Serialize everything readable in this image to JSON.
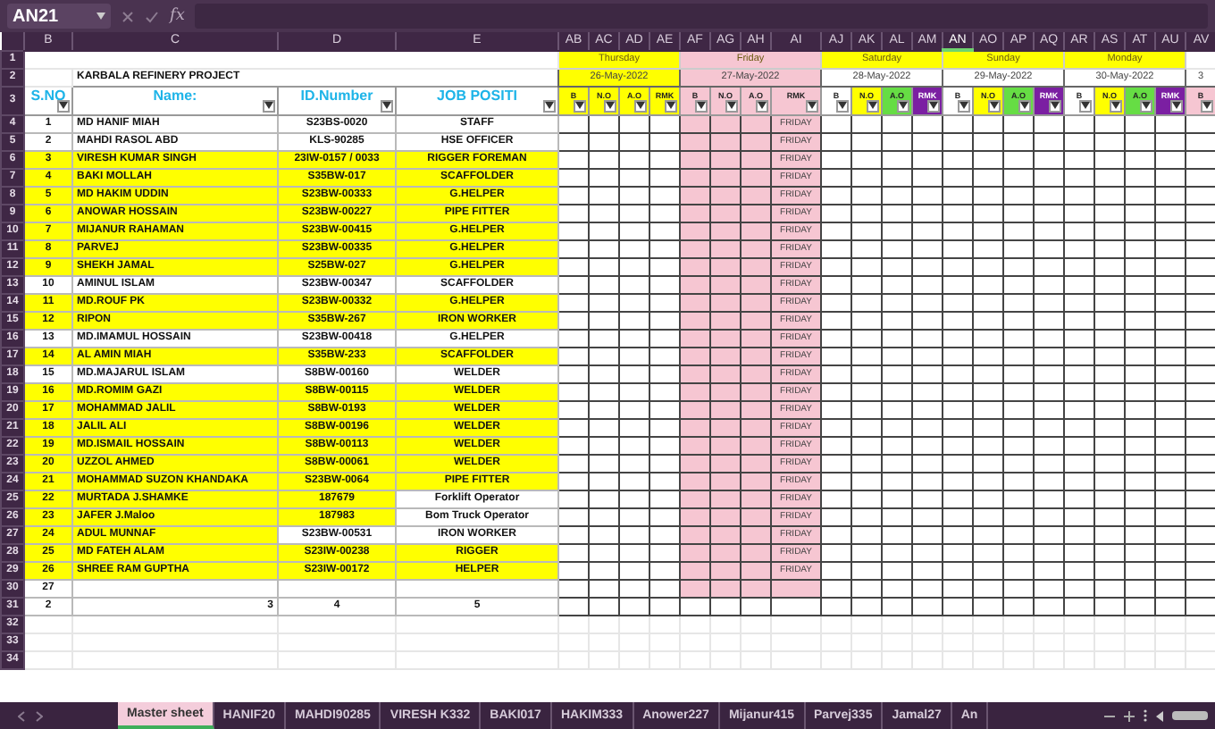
{
  "name_box": "AN21",
  "formula_label": "fx",
  "columns": [
    {
      "letter": "B",
      "selected": false
    },
    {
      "letter": "C",
      "selected": false
    },
    {
      "letter": "D",
      "selected": false
    },
    {
      "letter": "E",
      "selected": false
    },
    {
      "letter": "AB",
      "selected": false
    },
    {
      "letter": "AC",
      "selected": false
    },
    {
      "letter": "AD",
      "selected": false
    },
    {
      "letter": "AE",
      "selected": false
    },
    {
      "letter": "AF",
      "selected": false
    },
    {
      "letter": "AG",
      "selected": false
    },
    {
      "letter": "AH",
      "selected": false
    },
    {
      "letter": "AI",
      "selected": false
    },
    {
      "letter": "AJ",
      "selected": false
    },
    {
      "letter": "AK",
      "selected": false
    },
    {
      "letter": "AL",
      "selected": false
    },
    {
      "letter": "AM",
      "selected": false
    },
    {
      "letter": "AN",
      "selected": true
    },
    {
      "letter": "AO",
      "selected": false
    },
    {
      "letter": "AP",
      "selected": false
    },
    {
      "letter": "AQ",
      "selected": false
    },
    {
      "letter": "AR",
      "selected": false
    },
    {
      "letter": "AS",
      "selected": false
    },
    {
      "letter": "AT",
      "selected": false
    },
    {
      "letter": "AU",
      "selected": false
    },
    {
      "letter": "AV",
      "selected": false
    }
  ],
  "row_numbers": [
    "1",
    "2",
    "3",
    "4",
    "5",
    "6",
    "7",
    "8",
    "9",
    "10",
    "11",
    "12",
    "13",
    "14",
    "15",
    "16",
    "17",
    "18",
    "19",
    "20",
    "21",
    "22",
    "23",
    "24",
    "25",
    "26",
    "27",
    "28",
    "29",
    "30",
    "31",
    "32",
    "33",
    "34"
  ],
  "title": "KARBALA REFINERY PROJECT",
  "headers": [
    "S.NO",
    "Name:",
    "ID.Number",
    "JOB POSITI"
  ],
  "days": [
    {
      "day": "Thursday",
      "kind": "workday",
      "color": "#ffff00",
      "date": {
        "text": "26-May-2022",
        "color": "#ffff00"
      },
      "sub": [
        {
          "label": "B",
          "color": "#ffff00"
        },
        {
          "label": "N.O",
          "color": "#ffff00"
        },
        {
          "label": "A.O",
          "color": "#ffff00"
        },
        {
          "label": "RMK",
          "color": "#ffff00"
        }
      ]
    },
    {
      "day": "Friday",
      "kind": "holiday",
      "color": "#f6c6d2",
      "body": {
        "color": "#f6c6d2"
      },
      "date": {
        "text": "27-May-2022",
        "color": "#f6c6d2"
      },
      "sub": [
        {
          "label": "B",
          "color": "#f6c6d2"
        },
        {
          "label": "N.O",
          "color": "#f6c6d2"
        },
        {
          "label": "A.O",
          "color": "#f6c6d2"
        },
        {
          "label": "RMK",
          "color": "#f6c6d2"
        }
      ]
    },
    {
      "day": "Saturday",
      "kind": "workday",
      "color": "#ffff00",
      "date": {
        "text": "28-May-2022",
        "color": "#ffffff"
      },
      "sub": [
        {
          "label": "B",
          "color": "#ffffff"
        },
        {
          "label": "N.O",
          "color": "#ffff00"
        },
        {
          "label": "A.O",
          "color": "#66dd44"
        },
        {
          "label": "RMK",
          "color": "#7b1fa2"
        }
      ]
    },
    {
      "day": "Sunday",
      "kind": "workday",
      "color": "#ffff00",
      "date": {
        "text": "29-May-2022",
        "color": "#ffffff"
      },
      "sub": [
        {
          "label": "B",
          "color": "#ffffff"
        },
        {
          "label": "N.O",
          "color": "#ffff00"
        },
        {
          "label": "A.O",
          "color": "#66dd44"
        },
        {
          "label": "RMK",
          "color": "#7b1fa2"
        }
      ]
    },
    {
      "day": "Monday",
      "kind": "workday",
      "color": "#ffff00",
      "date": {
        "text": "30-May-2022",
        "color": "#ffffff"
      },
      "sub": [
        {
          "label": "B",
          "color": "#ffffff"
        },
        {
          "label": "N.O",
          "color": "#ffff00"
        },
        {
          "label": "A.O",
          "color": "#66dd44"
        },
        {
          "label": "RMK",
          "color": "#7b1fa2"
        }
      ]
    },
    {
      "kind": "workday",
      "color": "#ffffff",
      "date": {
        "text": "3",
        "color": "#ffffff"
      },
      "sub": [
        {
          "label": "B",
          "color": "#f6c6d2"
        }
      ]
    }
  ],
  "employees": [
    {
      "kind": "employee",
      "cells": [
        "1",
        "MD HANIF MIAH",
        "S23BS-0020",
        "STAFF"
      ],
      "highlighted": [
        false,
        false,
        false,
        false
      ],
      "friday_remark": "FRIDAY"
    },
    {
      "kind": "employee",
      "cells": [
        "2",
        "MAHDI RASOL ABD",
        "KLS-90285",
        "HSE OFFICER"
      ],
      "highlighted": [
        false,
        false,
        false,
        false
      ],
      "friday_remark": "FRIDAY"
    },
    {
      "kind": "employee",
      "cells": [
        "3",
        "VIRESH KUMAR SINGH",
        "23IW-0157 / 0033",
        "RIGGER FOREMAN"
      ],
      "highlighted": [
        true,
        true,
        true,
        true
      ],
      "friday_remark": "FRIDAY"
    },
    {
      "kind": "employee",
      "cells": [
        "4",
        "BAKI MOLLAH",
        "S35BW-017",
        "SCAFFOLDER"
      ],
      "highlighted": [
        true,
        true,
        true,
        true
      ],
      "friday_remark": "FRIDAY"
    },
    {
      "kind": "employee",
      "cells": [
        "5",
        "MD HAKIM UDDIN",
        "S23BW-00333",
        "G.HELPER"
      ],
      "highlighted": [
        true,
        true,
        true,
        true
      ],
      "friday_remark": "FRIDAY"
    },
    {
      "kind": "employee",
      "cells": [
        "6",
        "ANOWAR HOSSAIN",
        "S23BW-00227",
        "PIPE FITTER"
      ],
      "highlighted": [
        true,
        true,
        true,
        true
      ],
      "friday_remark": "FRIDAY"
    },
    {
      "kind": "employee",
      "cells": [
        "7",
        "MIJANUR RAHAMAN",
        "S23BW-00415",
        "G.HELPER"
      ],
      "highlighted": [
        true,
        true,
        true,
        true
      ],
      "friday_remark": "FRIDAY"
    },
    {
      "kind": "employee",
      "cells": [
        "8",
        "PARVEJ",
        "S23BW-00335",
        "G.HELPER"
      ],
      "highlighted": [
        true,
        true,
        true,
        true
      ],
      "friday_remark": "FRIDAY"
    },
    {
      "kind": "employee",
      "cells": [
        "9",
        "SHEKH JAMAL",
        "S25BW-027",
        "G.HELPER"
      ],
      "highlighted": [
        true,
        true,
        true,
        true
      ],
      "friday_remark": "FRIDAY"
    },
    {
      "kind": "employee",
      "cells": [
        "10",
        "AMINUL ISLAM",
        "S23BW-00347",
        "SCAFFOLDER"
      ],
      "highlighted": [
        false,
        false,
        false,
        false
      ],
      "friday_remark": "FRIDAY"
    },
    {
      "kind": "employee",
      "cells": [
        "11",
        "MD.ROUF PK",
        "S23BW-00332",
        "G.HELPER"
      ],
      "highlighted": [
        true,
        true,
        true,
        true
      ],
      "friday_remark": "FRIDAY"
    },
    {
      "kind": "employee",
      "cells": [
        "12",
        "RIPON",
        "S35BW-267",
        "IRON WORKER"
      ],
      "highlighted": [
        true,
        true,
        true,
        true
      ],
      "friday_remark": "FRIDAY"
    },
    {
      "kind": "employee",
      "cells": [
        "13",
        "MD.IMAMUL HOSSAIN",
        "S23BW-00418",
        "G.HELPER"
      ],
      "highlighted": [
        false,
        false,
        false,
        false
      ],
      "friday_remark": "FRIDAY"
    },
    {
      "kind": "employee",
      "cells": [
        "14",
        "AL AMIN MIAH",
        "S35BW-233",
        "SCAFFOLDER"
      ],
      "highlighted": [
        true,
        true,
        true,
        true
      ],
      "friday_remark": "FRIDAY"
    },
    {
      "kind": "employee",
      "cells": [
        "15",
        "MD.MAJARUL ISLAM",
        "S8BW-00160",
        "WELDER"
      ],
      "highlighted": [
        false,
        false,
        false,
        false
      ],
      "friday_remark": "FRIDAY"
    },
    {
      "kind": "employee",
      "cells": [
        "16",
        "MD.ROMIM GAZI",
        "S8BW-00115",
        "WELDER"
      ],
      "highlighted": [
        true,
        true,
        true,
        true
      ],
      "friday_remark": "FRIDAY"
    },
    {
      "kind": "employee",
      "cells": [
        "17",
        "MOHAMMAD JALIL",
        "S8BW-0193",
        "WELDER"
      ],
      "highlighted": [
        true,
        true,
        true,
        true
      ],
      "friday_remark": "FRIDAY"
    },
    {
      "kind": "employee",
      "cells": [
        "18",
        "JALIL ALI",
        "S8BW-00196",
        "WELDER"
      ],
      "highlighted": [
        true,
        true,
        true,
        true
      ],
      "friday_remark": "FRIDAY"
    },
    {
      "kind": "employee",
      "cells": [
        "19",
        "MD.ISMAIL HOSSAIN",
        "S8BW-00113",
        "WELDER"
      ],
      "highlighted": [
        true,
        true,
        true,
        true
      ],
      "friday_remark": "FRIDAY"
    },
    {
      "kind": "employee",
      "cells": [
        "20",
        "UZZOL AHMED",
        "S8BW-00061",
        "WELDER"
      ],
      "highlighted": [
        true,
        true,
        true,
        true
      ],
      "friday_remark": "FRIDAY"
    },
    {
      "kind": "employee",
      "cells": [
        "21",
        "MOHAMMAD SUZON KHANDAKA",
        "S23BW-0064",
        "PIPE FITTER"
      ],
      "highlighted": [
        true,
        true,
        true,
        true
      ],
      "friday_remark": "FRIDAY"
    },
    {
      "kind": "employee",
      "cells": [
        "22",
        "MURTADA J.SHAMKE",
        "187679",
        "Forklift Operator"
      ],
      "highlighted": [
        true,
        true,
        true,
        false
      ],
      "friday_remark": "FRIDAY"
    },
    {
      "kind": "employee",
      "cells": [
        "23",
        "JAFER J.Maloo",
        "187983",
        "Bom Truck Operator"
      ],
      "highlighted": [
        true,
        true,
        true,
        false
      ],
      "friday_remark": "FRIDAY"
    },
    {
      "kind": "employee",
      "cells": [
        "24",
        "ADUL MUNNAF",
        "S23BW-00531",
        "IRON WORKER"
      ],
      "highlighted": [
        true,
        true,
        false,
        false
      ],
      "friday_remark": "FRIDAY"
    },
    {
      "kind": "employee",
      "cells": [
        "25",
        "MD FATEH ALAM",
        "S23IW-00238",
        "RIGGER"
      ],
      "highlighted": [
        true,
        true,
        true,
        true
      ],
      "friday_remark": "FRIDAY"
    },
    {
      "kind": "employee",
      "cells": [
        "26",
        "SHREE RAM GUPTHA",
        "S23IW-00172",
        "HELPER"
      ],
      "highlighted": [
        true,
        true,
        true,
        true
      ],
      "friday_remark": "FRIDAY"
    },
    {
      "kind": "employee",
      "cells": [
        "27"
      ],
      "highlighted": [
        false,
        false,
        false,
        false
      ]
    },
    {
      "kind": "numbering",
      "cells": [
        "2",
        "3",
        "4",
        "5"
      ],
      "highlighted": [
        false,
        false,
        false,
        false
      ]
    }
  ],
  "sheet_tabs": [
    {
      "label": "Master sheet",
      "selected": true
    },
    {
      "label": "HANIF20",
      "selected": false
    },
    {
      "label": "MAHDI90285",
      "selected": false
    },
    {
      "label": "VIRESH K332",
      "selected": false
    },
    {
      "label": "BAKI017",
      "selected": false
    },
    {
      "label": "HAKIM333",
      "selected": false
    },
    {
      "label": "Anower227",
      "selected": false
    },
    {
      "label": "Mijanur415",
      "selected": false
    },
    {
      "label": "Parvej335",
      "selected": false
    },
    {
      "label": "Jamal27",
      "selected": false
    },
    {
      "label": "An",
      "selected": false
    }
  ]
}
